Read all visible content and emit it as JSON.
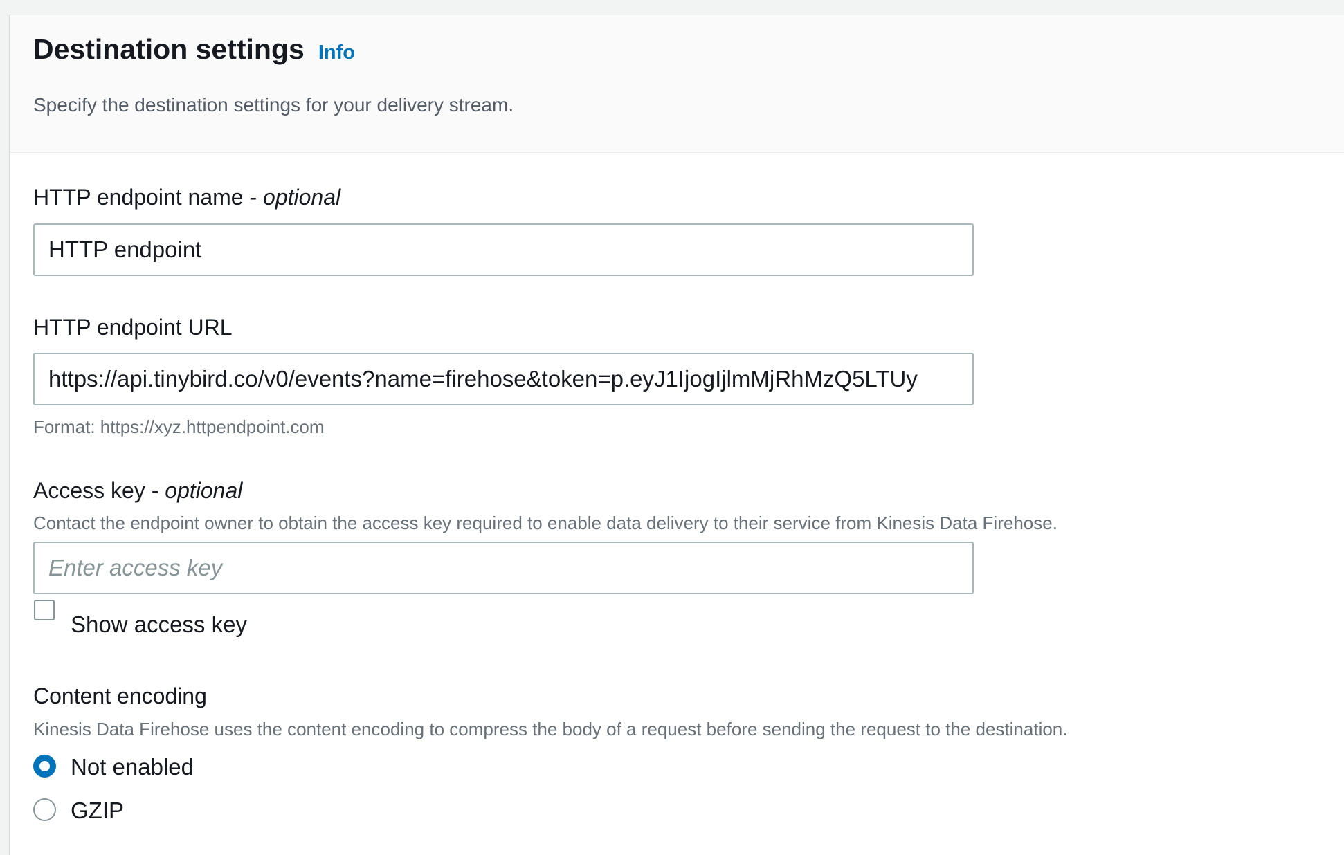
{
  "header": {
    "title": "Destination settings",
    "info_link": "Info",
    "subtitle": "Specify the destination settings for your delivery stream."
  },
  "endpoint_name": {
    "label": "HTTP endpoint name - ",
    "label_suffix": "optional",
    "value": "HTTP endpoint"
  },
  "endpoint_url": {
    "label": "HTTP endpoint URL",
    "value": "https://api.tinybird.co/v0/events?name=firehose&token=p.eyJ1IjogIjlmMjRhMzQ5LTUy",
    "hint": "Format: https://xyz.httpendpoint.com"
  },
  "access_key": {
    "label": "Access key - ",
    "label_suffix": "optional",
    "description": "Contact the endpoint owner to obtain the access key required to enable data delivery to their service from Kinesis Data Firehose.",
    "value": "",
    "placeholder": "Enter access key",
    "show_label": "Show access key",
    "show_checked": false
  },
  "content_encoding": {
    "label": "Content encoding",
    "description": "Kinesis Data Firehose uses the content encoding to compress the body of a request before sending the request to the destination.",
    "options": [
      {
        "label": "Not enabled",
        "selected": true
      },
      {
        "label": "GZIP",
        "selected": false
      }
    ]
  },
  "colors": {
    "accent": "#0073bb",
    "text": "#16191f",
    "muted": "#687078",
    "border": "#aab7b8"
  }
}
